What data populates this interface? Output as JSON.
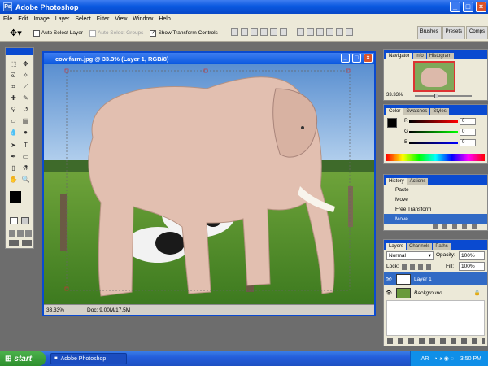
{
  "app": {
    "title": "Adobe Photoshop"
  },
  "menu": [
    "File",
    "Edit",
    "Image",
    "Layer",
    "Select",
    "Filter",
    "View",
    "Window",
    "Help"
  ],
  "options": {
    "auto_select_layer": "Auto Select Layer",
    "auto_select_groups": "Auto Select Groups",
    "show_transform_controls": "Show Transform Controls",
    "auto_select_layer_checked": false,
    "show_transform_checked": true
  },
  "palette_tabs": [
    "Brushes",
    "Presets",
    "Comps"
  ],
  "document": {
    "title": "cow farm.jpg @ 33.3% (Layer 1, RGB/8)",
    "zoom": "33.33%",
    "doc_size": "Doc: 9.00M/17.5M"
  },
  "navigator": {
    "tabs": [
      "Navigator",
      "Info",
      "Histogram"
    ],
    "zoom": "33.33%"
  },
  "color": {
    "tabs": [
      "Color",
      "Swatches",
      "Styles"
    ],
    "channels": [
      {
        "label": "R",
        "value": "0"
      },
      {
        "label": "G",
        "value": "0"
      },
      {
        "label": "B",
        "value": "0"
      }
    ]
  },
  "history": {
    "tabs": [
      "History",
      "Actions"
    ],
    "items": [
      "Paste",
      "Move",
      "Free Transform",
      "Move"
    ],
    "active_index": 3
  },
  "layers": {
    "tabs": [
      "Layers",
      "Channels",
      "Paths"
    ],
    "blend_mode": "Normal",
    "opacity_label": "Opacity:",
    "opacity": "100%",
    "lock_label": "Lock:",
    "fill_label": "Fill:",
    "fill": "100%",
    "items": [
      {
        "name": "Layer 1",
        "active": true
      },
      {
        "name": "Background",
        "active": false
      }
    ]
  },
  "taskbar": {
    "start_label": "start",
    "task_label": "Adobe Photoshop",
    "tray_lang": "AR",
    "time": "3:50 PM"
  },
  "colors": {
    "xp_blue": "#0a58e0",
    "panel_bg": "#ece9d8",
    "selection": "#316ac5",
    "start_green": "#3a9a3a"
  }
}
